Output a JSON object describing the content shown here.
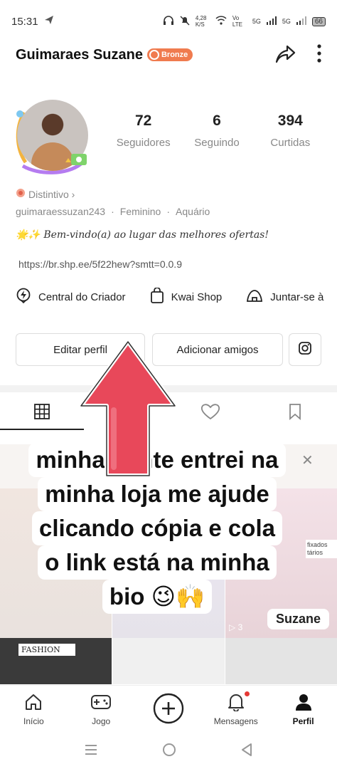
{
  "status_bar": {
    "time": "15:31",
    "speed": "4,28 K/S",
    "net1": "Vo LTE",
    "net2": "5G",
    "net3": "5G",
    "battery": "66"
  },
  "header": {
    "name": "Guimaraes Suzane",
    "badge": "Bronze"
  },
  "stats": [
    {
      "num": "72",
      "label": "Seguidores"
    },
    {
      "num": "6",
      "label": "Seguindo"
    },
    {
      "num": "394",
      "label": "Curtidas"
    }
  ],
  "distintivo": "Distintivo ›",
  "meta": {
    "username": "guimaraessuzan243",
    "gender": "Feminino",
    "sign": "Aquário",
    "sep": "·"
  },
  "bio": {
    "welcome": "🌟✨ Bem-vindo(a) ao lugar das melhores ofertas!",
    "link": "https://br.shp.ee/5f22hew?smtt=0.0.9"
  },
  "quick_links": [
    {
      "label": "Central do Criador",
      "icon": "creator-bolt-icon"
    },
    {
      "label": "Kwai Shop",
      "icon": "shopping-bag-icon"
    },
    {
      "label": "Juntar-se à",
      "icon": "tent-icon"
    }
  ],
  "buttons": {
    "edit": "Editar perfil",
    "add_friends": "Adicionar amigos"
  },
  "grid": {
    "tag_text": "fixados tários",
    "name_tag": "Suzane",
    "play_count": "3",
    "fashion_text": "FASHION"
  },
  "caption": {
    "lines": [
      "minha gente entrei na",
      "minha loja me ajude",
      "clicando cópia e cola",
      "o link está na minha",
      "bio 😉🙌"
    ]
  },
  "nav": [
    {
      "label": "Início",
      "icon": "home-icon"
    },
    {
      "label": "Jogo",
      "icon": "game-controller-icon"
    },
    {
      "label": "",
      "icon": "plus-circle-icon"
    },
    {
      "label": "Mensagens",
      "icon": "bell-icon"
    },
    {
      "label": "Perfil",
      "icon": "profile-icon"
    }
  ],
  "colors": {
    "badge": "#f07b4f",
    "arrow": "#e8485a",
    "notification": "#e53935"
  }
}
